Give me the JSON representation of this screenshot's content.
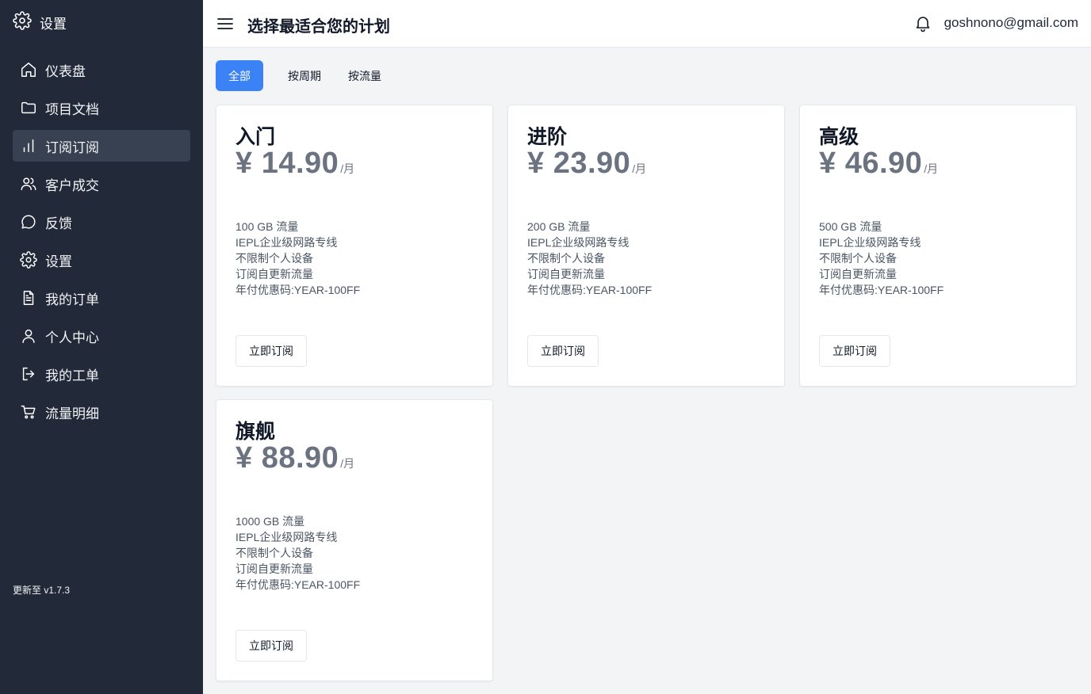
{
  "sidebar": {
    "brand": {
      "label": "设置",
      "icon": "gear-icon"
    },
    "items": [
      {
        "label": "仪表盘",
        "icon": "home-icon",
        "active": false
      },
      {
        "label": "项目文档",
        "icon": "folder-icon",
        "active": false
      },
      {
        "label": "订阅订阅",
        "icon": "bar-chart-icon",
        "active": true
      },
      {
        "label": "客户成交",
        "icon": "users-icon",
        "active": false
      },
      {
        "label": "反馈",
        "icon": "chat-icon",
        "active": false
      },
      {
        "label": "设置",
        "icon": "gear-icon",
        "active": false
      },
      {
        "label": "我的订单",
        "icon": "document-icon",
        "active": false
      },
      {
        "label": "个人中心",
        "icon": "user-icon",
        "active": false
      },
      {
        "label": "我的工单",
        "icon": "logout-icon",
        "active": false
      },
      {
        "label": "流量明细",
        "icon": "cart-icon",
        "active": false
      }
    ],
    "version": "更新至 v1.7.3"
  },
  "header": {
    "title": "选择最适合您的计划",
    "email": "goshnono@gmail.com"
  },
  "tabs": [
    {
      "label": "全部",
      "active": true
    },
    {
      "label": "按周期",
      "active": false
    },
    {
      "label": "按流量",
      "active": false
    }
  ],
  "plans": [
    {
      "name": "入门",
      "price": "¥ 14.90",
      "unit": "/月",
      "features": [
        "100 GB 流量",
        "IEPL企业级网路专线",
        "不限制个人设备",
        "订阅自更新流量",
        "年付优惠码:YEAR-100FF"
      ],
      "button": "立即订阅"
    },
    {
      "name": "进阶",
      "price": "¥ 23.90",
      "unit": "/月",
      "features": [
        "200 GB 流量",
        "IEPL企业级网路专线",
        "不限制个人设备",
        "订阅自更新流量",
        "年付优惠码:YEAR-100FF"
      ],
      "button": "立即订阅"
    },
    {
      "name": "高级",
      "price": "¥ 46.90",
      "unit": "/月",
      "features": [
        "500 GB 流量",
        "IEPL企业级网路专线",
        "不限制个人设备",
        "订阅自更新流量",
        "年付优惠码:YEAR-100FF"
      ],
      "button": "立即订阅"
    },
    {
      "name": "旗舰",
      "price": "¥ 88.90",
      "unit": "/月",
      "features": [
        "1000 GB 流量",
        "IEPL企业级网路专线",
        "不限制个人设备",
        "订阅自更新流量",
        "年付优惠码:YEAR-100FF"
      ],
      "button": "立即订阅"
    }
  ],
  "colors": {
    "sidebar_bg": "#222a39",
    "active_item_bg": "#374151",
    "accent": "#3b82f6",
    "page_bg": "#f3f4f6",
    "price": "#6b7280"
  }
}
